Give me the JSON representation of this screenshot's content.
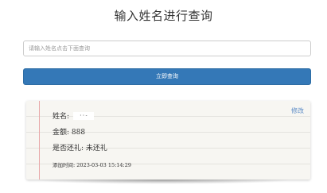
{
  "header": {
    "title": "输入姓名进行查询"
  },
  "search": {
    "placeholder": "请输入姓名点击下面查询",
    "value": ""
  },
  "query_button": {
    "label": "立即查询"
  },
  "record": {
    "edit_label": "修改",
    "name_label": "姓名:",
    "name_value": "··-",
    "amount_label": "金额:",
    "amount_value": "888",
    "status_label": "是否还礼:",
    "status_value": "未还礼",
    "time_label": "添加时间:",
    "time_value": "2023-03-03 15:14:29"
  },
  "colors": {
    "primary_button": "#3478b7",
    "edit_link": "#5b8bc6",
    "margin_line": "#e8a9a9",
    "paper": "#f7f6f2"
  }
}
